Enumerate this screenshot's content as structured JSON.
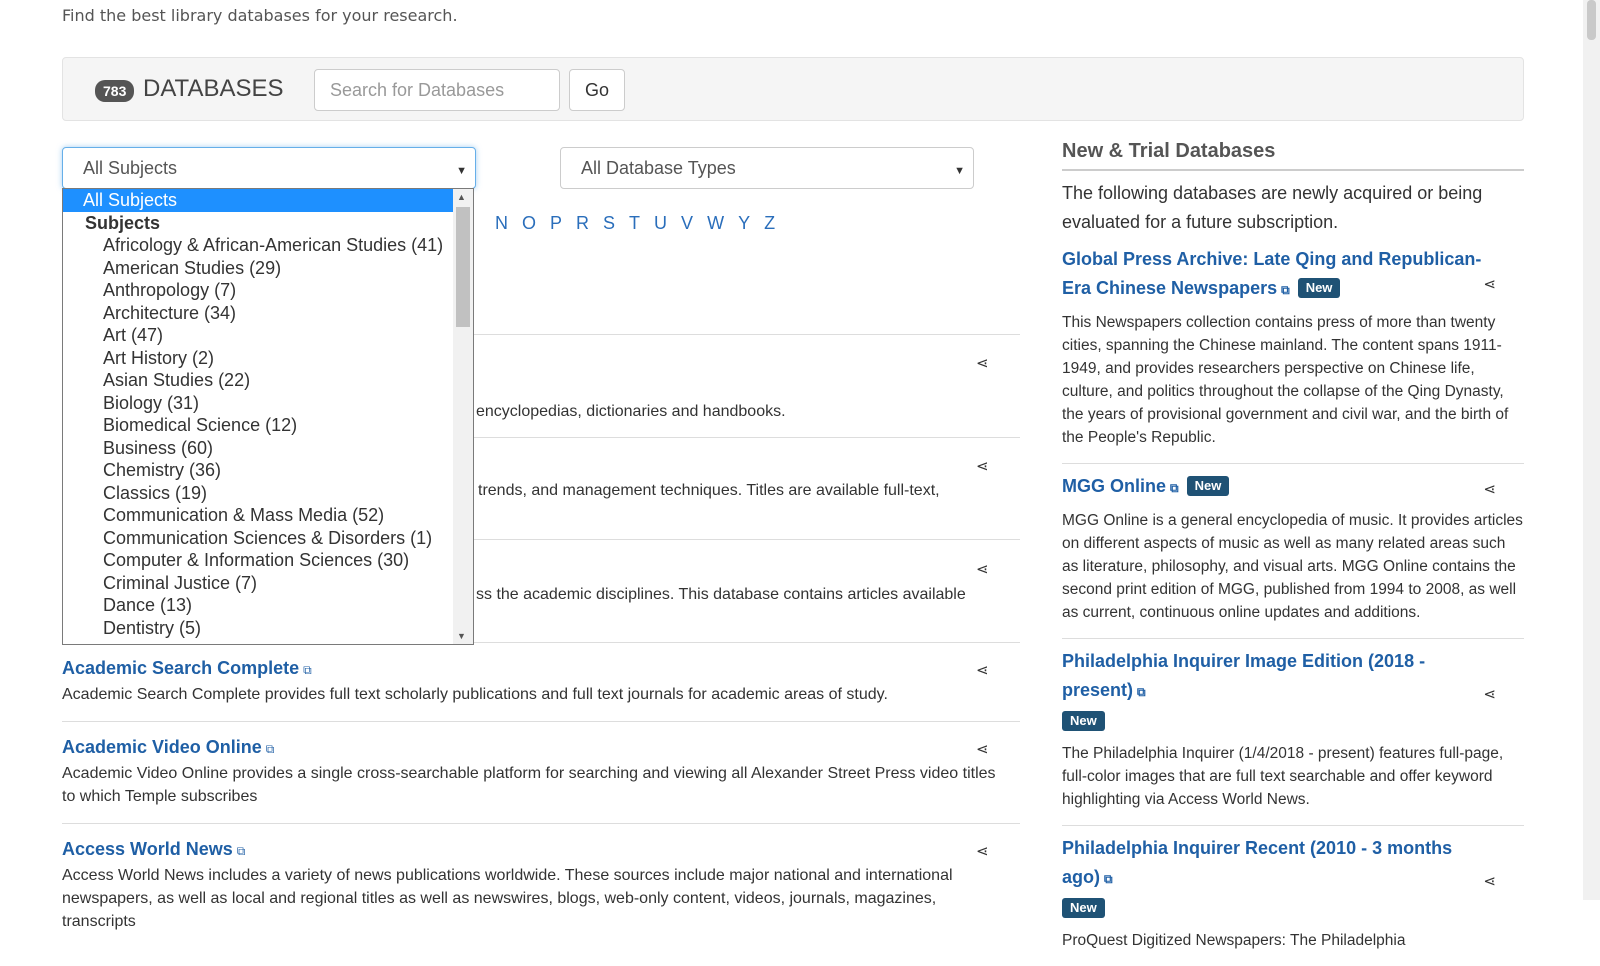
{
  "tagline": "Find the best library databases for your research.",
  "header": {
    "count": "783",
    "title": "DATABASES",
    "search_placeholder": "Search for Databases",
    "go_label": "Go"
  },
  "filters": {
    "subjects_value": "All Subjects",
    "types_value": "All Database Types"
  },
  "az_letters": [
    "N",
    "O",
    "P",
    "R",
    "S",
    "T",
    "U",
    "V",
    "W",
    "Y",
    "Z"
  ],
  "partial_descriptions": [
    "encyclopedias, dictionaries and handbooks.",
    "trends, and management techniques. Titles are available full-text,",
    "ss the academic disciplines. This database contains articles available"
  ],
  "databases": [
    {
      "title": "Academic Search Complete",
      "description": "Academic Search Complete provides full text scholarly publications and full text journals for academic areas of study."
    },
    {
      "title": "Academic Video Online",
      "description": "Academic Video Online provides a single cross-searchable platform for searching and viewing all Alexander Street Press video titles to which Temple subscribes"
    },
    {
      "title": "Access World News",
      "description": "Access World News includes a variety of news publications worldwide. These sources include major national and international newspapers, as well as local and regional titles as well as newswires, blogs, web-only content, videos, journals, magazines, transcripts"
    }
  ],
  "right_column": {
    "title": "New & Trial Databases",
    "intro": "The following databases are newly acquired or being evaluated for a future subscription.",
    "new_label": "New",
    "items": [
      {
        "title": "Global Press Archive: Late Qing and Republican-Era Chinese Newspapers",
        "description": "This Newspapers collection contains press of more than twenty cities, spanning the Chinese mainland. The content spans 1911-1949, and provides researchers perspective on Chinese life, culture, and politics throughout the collapse of the Qing Dynasty, the years of provisional government and civil war, and the birth of the People's Republic."
      },
      {
        "title": "MGG Online",
        "description": "MGG Online is a general encyclopedia of music. It provides articles on different aspects of music as well as many related areas such as literature, philosophy, and visual arts. MGG Online contains the second print edition of MGG, published from 1994 to 2008, as well as current, continuous online updates and additions."
      },
      {
        "title": "Philadelphia Inquirer Image Edition (2018 - present)",
        "description": "The Philadelphia Inquirer (1/4/2018 - present) features full-page, full-color images that are full text searchable and offer keyword highlighting via Access World News."
      },
      {
        "title": "Philadelphia Inquirer Recent (2010 - 3 months ago)",
        "description": "ProQuest Digitized Newspapers: The Philadelphia"
      }
    ]
  },
  "dropdown": {
    "selected": "All Subjects",
    "group": "Subjects",
    "options": [
      "Africology & African-American Studies (41)",
      "American Studies (29)",
      "Anthropology (7)",
      "Architecture (34)",
      "Art (47)",
      "Art History (2)",
      "Asian Studies (22)",
      "Biology (31)",
      "Biomedical Science (12)",
      "Business (60)",
      "Chemistry (36)",
      "Classics (19)",
      "Communication & Mass Media (52)",
      "Communication Sciences & Disorders (1)",
      "Computer & Information Sciences (30)",
      "Criminal Justice (7)",
      "Dance (13)",
      "Dentistry (5)"
    ]
  }
}
